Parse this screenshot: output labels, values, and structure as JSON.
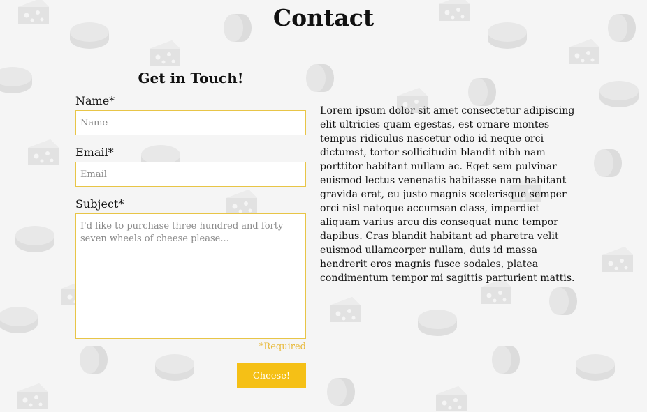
{
  "page": {
    "title": "Contact"
  },
  "form": {
    "title": "Get in Touch!",
    "name": {
      "label": "Name*",
      "placeholder": "Name"
    },
    "email": {
      "label": "Email*",
      "placeholder": "Email"
    },
    "subject": {
      "label": "Subject*",
      "placeholder": "I'd like to purchase three hundred and forty seven wheels of cheese please..."
    },
    "required_note": "*Required",
    "submit_label": "Cheese!"
  },
  "info": {
    "text": "Lorem ipsum dolor sit amet consectetur adipiscing elit ultricies quam egestas, est ornare montes tempus ridiculus nascetur odio id neque orci dictumst, tortor sollicitudin blandit nibh nam porttitor habitant nullam ac. Eget sem pulvinar euismod lectus venenatis habitasse nam habitant gravida erat, eu justo magnis scelerisque semper orci nisl natoque accumsan class, imperdiet aliquam varius arcu dis consequat nunc tempor dapibus. Cras blandit habitant ad pharetra velit euismod ullamcorper nullam, duis id massa hendrerit eros magnis fusce sodales, platea condimentum tempor mi sagittis parturient mattis."
  },
  "background": {
    "pattern_icons": [
      "cheese-wheel-icon",
      "cheese-wedge-icon"
    ]
  },
  "colors": {
    "accent": "#f5c016",
    "input_border": "#e8c547",
    "required": "#e8b93a",
    "background": "#f5f5f5"
  }
}
